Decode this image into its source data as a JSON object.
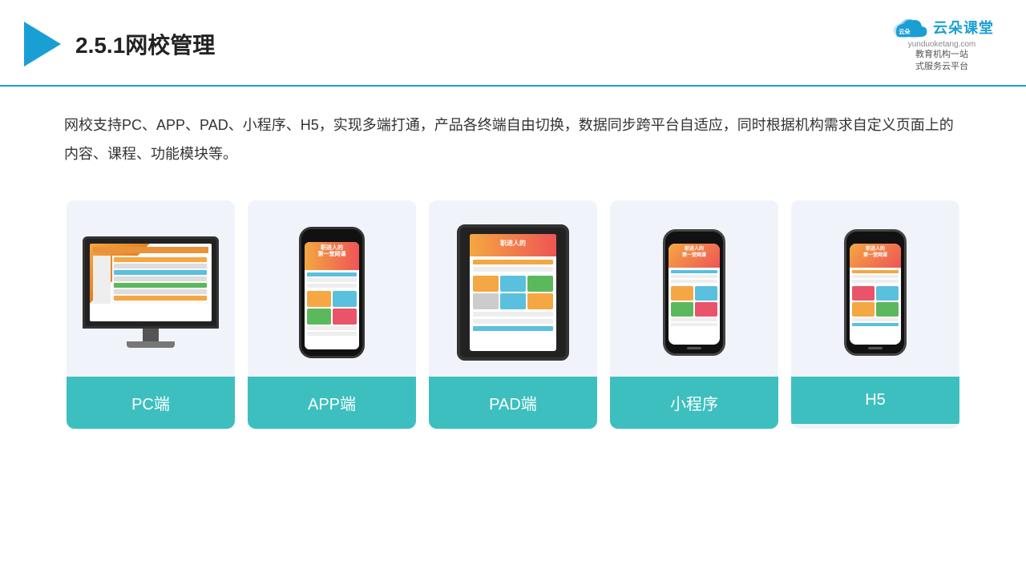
{
  "header": {
    "title": "2.5.1网校管理",
    "brand": {
      "name": "云朵课堂",
      "url": "yunduoketang.com",
      "tagline": "教育机构一站\n式服务云平台"
    }
  },
  "description": {
    "text": "网校支持PC、APP、PAD、小程序、H5，实现多端打通，产品各终端自由切换，数据同步跨平台自适应，同时根据机构需求自定义页面上的内容、课程、功能模块等。"
  },
  "cards": [
    {
      "id": "pc",
      "label": "PC端"
    },
    {
      "id": "app",
      "label": "APP端"
    },
    {
      "id": "pad",
      "label": "PAD端"
    },
    {
      "id": "miniprogram",
      "label": "小程序"
    },
    {
      "id": "h5",
      "label": "H5"
    }
  ],
  "colors": {
    "accent": "#1a9fd4",
    "card_label_bg": "#3dbfbf",
    "header_border": "#1a9fd4"
  }
}
